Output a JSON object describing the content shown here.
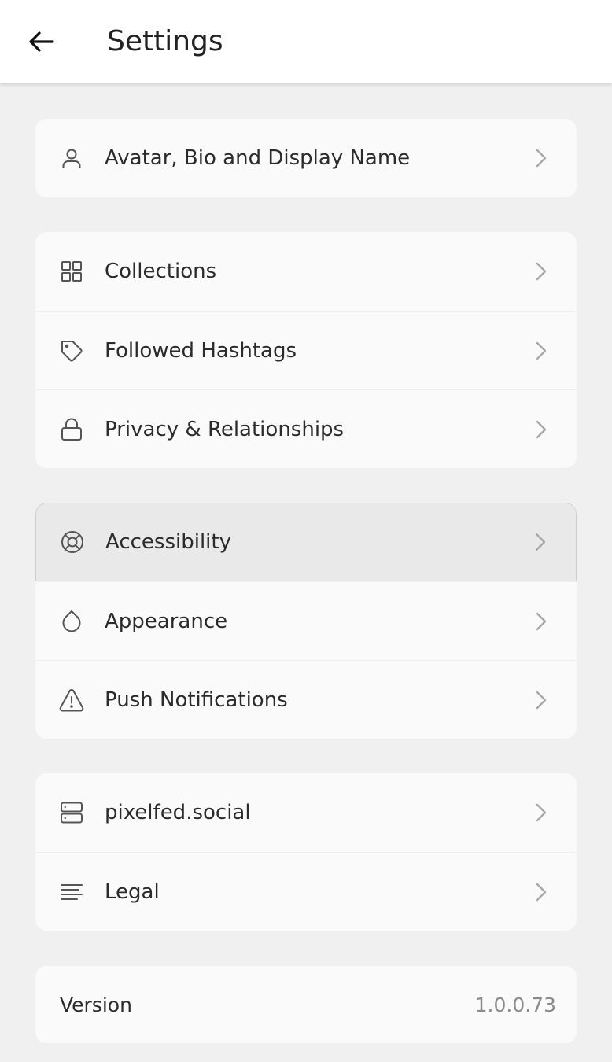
{
  "header": {
    "title": "Settings",
    "back_icon": "arrow-left-icon"
  },
  "groups": [
    {
      "items": [
        {
          "label": "Avatar, Bio and Display Name",
          "icon": "user-icon"
        }
      ]
    },
    {
      "items": [
        {
          "label": "Collections",
          "icon": "grid-icon"
        },
        {
          "label": "Followed Hashtags",
          "icon": "tag-icon"
        },
        {
          "label": "Privacy & Relationships",
          "icon": "lock-icon"
        }
      ]
    },
    {
      "items": [
        {
          "label": "Accessibility",
          "icon": "lifebuoy-icon",
          "state": "pressed"
        },
        {
          "label": "Appearance",
          "icon": "droplet-icon"
        },
        {
          "label": "Push Notifications",
          "icon": "alert-triangle-icon"
        }
      ]
    },
    {
      "items": [
        {
          "label": "pixelfed.social",
          "icon": "server-icon"
        },
        {
          "label": "Legal",
          "icon": "text-lines-icon"
        }
      ]
    }
  ],
  "version": {
    "label": "Version",
    "value": "1.0.0.73"
  },
  "colors": {
    "background": "#f0f0f0",
    "card": "#fafafa",
    "pressed": "#e9e9e9",
    "text": "#2b2b2b",
    "muted": "#8a8a8a",
    "chevron": "#a8a8a8"
  }
}
